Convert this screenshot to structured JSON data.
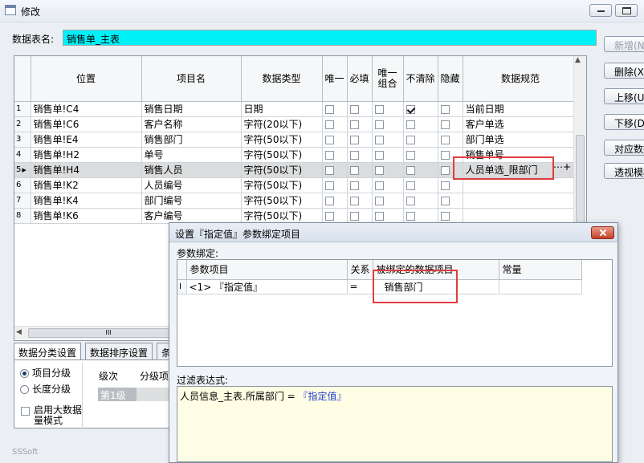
{
  "window": {
    "title": "修改"
  },
  "form": {
    "name_label": "数据表名:",
    "name_value": "销售单_主表"
  },
  "side_buttons": [
    "新增(N",
    "删除(X",
    "上移(U",
    "下移(D",
    "对应数据",
    "透视模板"
  ],
  "grid": {
    "columns": [
      "",
      "位置",
      "项目名",
      "数据类型",
      "唯一",
      "必填",
      "唯一组合",
      "不清除",
      "隐藏",
      "数据规范"
    ],
    "rows": [
      {
        "n": "1",
        "pos": "销售单!C4",
        "name": "销售日期",
        "type": "日期",
        "unique": false,
        "required": false,
        "combo": false,
        "keep": true,
        "hidden": false,
        "rule": "当前日期"
      },
      {
        "n": "2",
        "pos": "销售单!C6",
        "name": "客户名称",
        "type": "字符(20以下)",
        "unique": false,
        "required": false,
        "combo": false,
        "keep": false,
        "hidden": false,
        "rule": "客户单选"
      },
      {
        "n": "3",
        "pos": "销售单!E4",
        "name": "销售部门",
        "type": "字符(50以下)",
        "unique": false,
        "required": false,
        "combo": false,
        "keep": false,
        "hidden": false,
        "rule": "部门单选"
      },
      {
        "n": "4",
        "pos": "销售单!H2",
        "name": "单号",
        "type": "字符(50以下)",
        "unique": false,
        "required": false,
        "combo": false,
        "keep": false,
        "hidden": false,
        "rule": "销售单号"
      },
      {
        "n": "5",
        "pos": "销售单!H4",
        "name": "销售人员",
        "type": "字符(50以下)",
        "unique": false,
        "required": false,
        "combo": false,
        "keep": false,
        "hidden": false,
        "rule": "人员单选_限部门"
      },
      {
        "n": "6",
        "pos": "销售单!K2",
        "name": "人员编号",
        "type": "字符(50以下)",
        "unique": false,
        "required": false,
        "combo": false,
        "keep": false,
        "hidden": false,
        "rule": ""
      },
      {
        "n": "7",
        "pos": "销售单!K4",
        "name": "部门编号",
        "type": "字符(50以下)",
        "unique": false,
        "required": false,
        "combo": false,
        "keep": false,
        "hidden": false,
        "rule": ""
      },
      {
        "n": "8",
        "pos": "销售单!K6",
        "name": "客户编号",
        "type": "字符(50以下)",
        "unique": false,
        "required": false,
        "combo": false,
        "keep": false,
        "hidden": false,
        "rule": ""
      }
    ],
    "selected_row": "5",
    "scroll_indicator": "III"
  },
  "bottom_tabs": [
    "数据分类设置",
    "数据排序设置",
    "条"
  ],
  "classify": {
    "options": [
      "项目分级",
      "长度分级"
    ],
    "selected": "项目分级",
    "big_data_label": "启用大数据量模式",
    "cols": [
      "级次",
      "分级项"
    ],
    "first_level": "第1级"
  },
  "footer": {
    "brand": "SSSoft"
  },
  "dialog": {
    "title": "设置『指定值』参数绑定项目",
    "bind_label": "参数绑定:",
    "cols": [
      "参数项目",
      "关系",
      "被绑定的数据项目",
      "常量"
    ],
    "row": {
      "marker": "I",
      "param": "<1> 『指定值』",
      "rel": "=",
      "bound": "销售部门",
      "const": ""
    },
    "filter_label": "过滤表达式:",
    "filter_prefix": "人员信息_主表.所属部门 = ",
    "filter_token": "『指定值』"
  },
  "colors": {
    "name_field": "#00f0f8",
    "highlight": "#e23c3c",
    "token": "#1f3fd1"
  }
}
